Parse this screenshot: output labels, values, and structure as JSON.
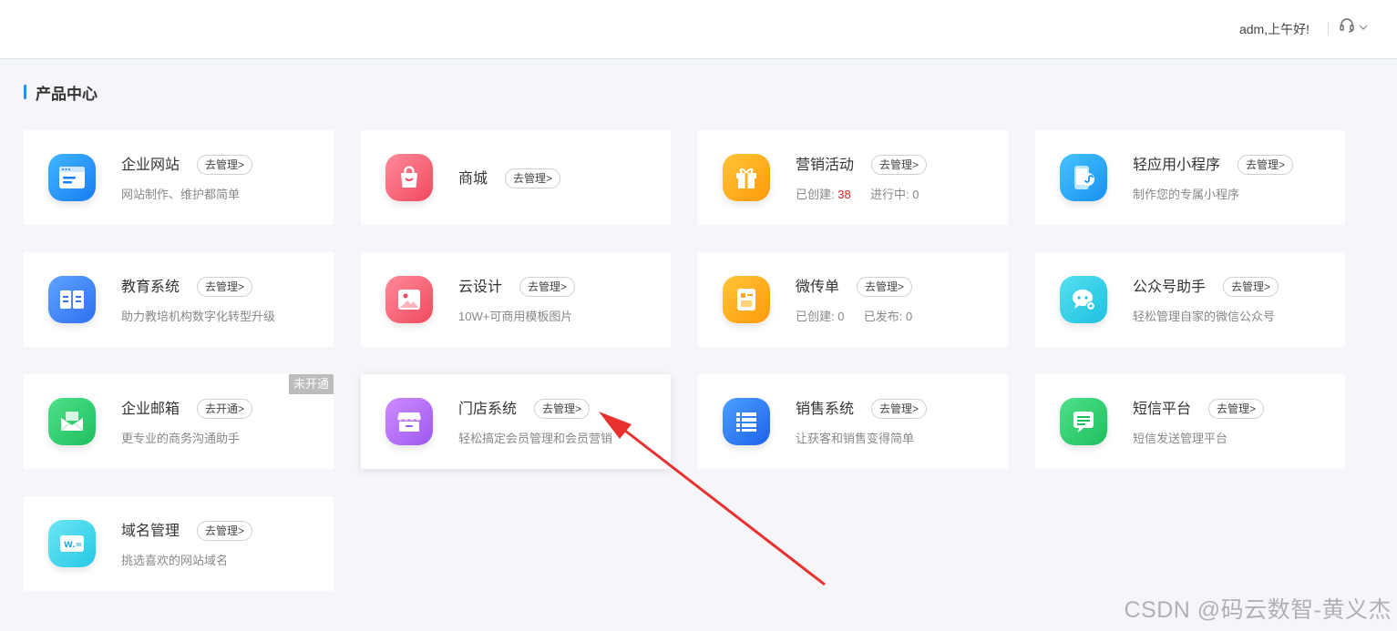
{
  "header": {
    "greeting": "adm,上午好!",
    "support_icon": "headset-icon",
    "dropdown_icon": "chevron-down-icon"
  },
  "section": {
    "title": "产品中心"
  },
  "cards": {
    "site": {
      "name": "企业网站",
      "action": "去管理>",
      "desc": "网站制作、维护都简单"
    },
    "mall": {
      "name": "商城",
      "action": "去管理>"
    },
    "mkt": {
      "name": "营销活动",
      "action": "去管理>",
      "created_label": "已创建:",
      "created": "38",
      "running_label": "进行中:",
      "running": "0"
    },
    "mini": {
      "name": "轻应用小程序",
      "action": "去管理>",
      "desc": "制作您的专属小程序"
    },
    "edu": {
      "name": "教育系统",
      "action": "去管理>",
      "desc": "助力教培机构数字化转型升级"
    },
    "design": {
      "name": "云设计",
      "action": "去管理>",
      "desc": "10W+可商用模板图片"
    },
    "flyer": {
      "name": "微传单",
      "action": "去管理>",
      "created_label": "已创建:",
      "created": "0",
      "published_label": "已发布:",
      "published": "0"
    },
    "mp": {
      "name": "公众号助手",
      "action": "去管理>",
      "desc": "轻松管理自家的微信公众号"
    },
    "mail": {
      "name": "企业邮箱",
      "action": "去开通>",
      "desc": "更专业的商务沟通助手",
      "badge": "未开通"
    },
    "store": {
      "name": "门店系统",
      "action": "去管理>",
      "desc": "轻松搞定会员管理和会员营销"
    },
    "sales": {
      "name": "销售系统",
      "action": "去管理>",
      "desc": "让获客和销售变得简单"
    },
    "sms": {
      "name": "短信平台",
      "action": "去管理>",
      "desc": "短信发送管理平台"
    },
    "domain": {
      "name": "域名管理",
      "action": "去管理>",
      "desc": "挑选喜欢的网站域名"
    }
  },
  "icons": {
    "site": "browser-window-icon",
    "mall": "shopping-bag-icon",
    "mkt": "gift-box-icon",
    "mini": "mini-program-icon",
    "edu": "open-book-icon",
    "design": "image-icon",
    "flyer": "flyer-icon",
    "mp": "wechat-chat-icon",
    "mail": "envelope-icon",
    "store": "storefront-icon",
    "sales": "list-icon",
    "sms": "message-icon",
    "domain": "domain-icon"
  },
  "colors": {
    "accent": "#2d8cf0",
    "highlight_number": "#e42222",
    "annotation_arrow": "#e8312f"
  },
  "watermark": "CSDN @码云数智-黄义杰"
}
